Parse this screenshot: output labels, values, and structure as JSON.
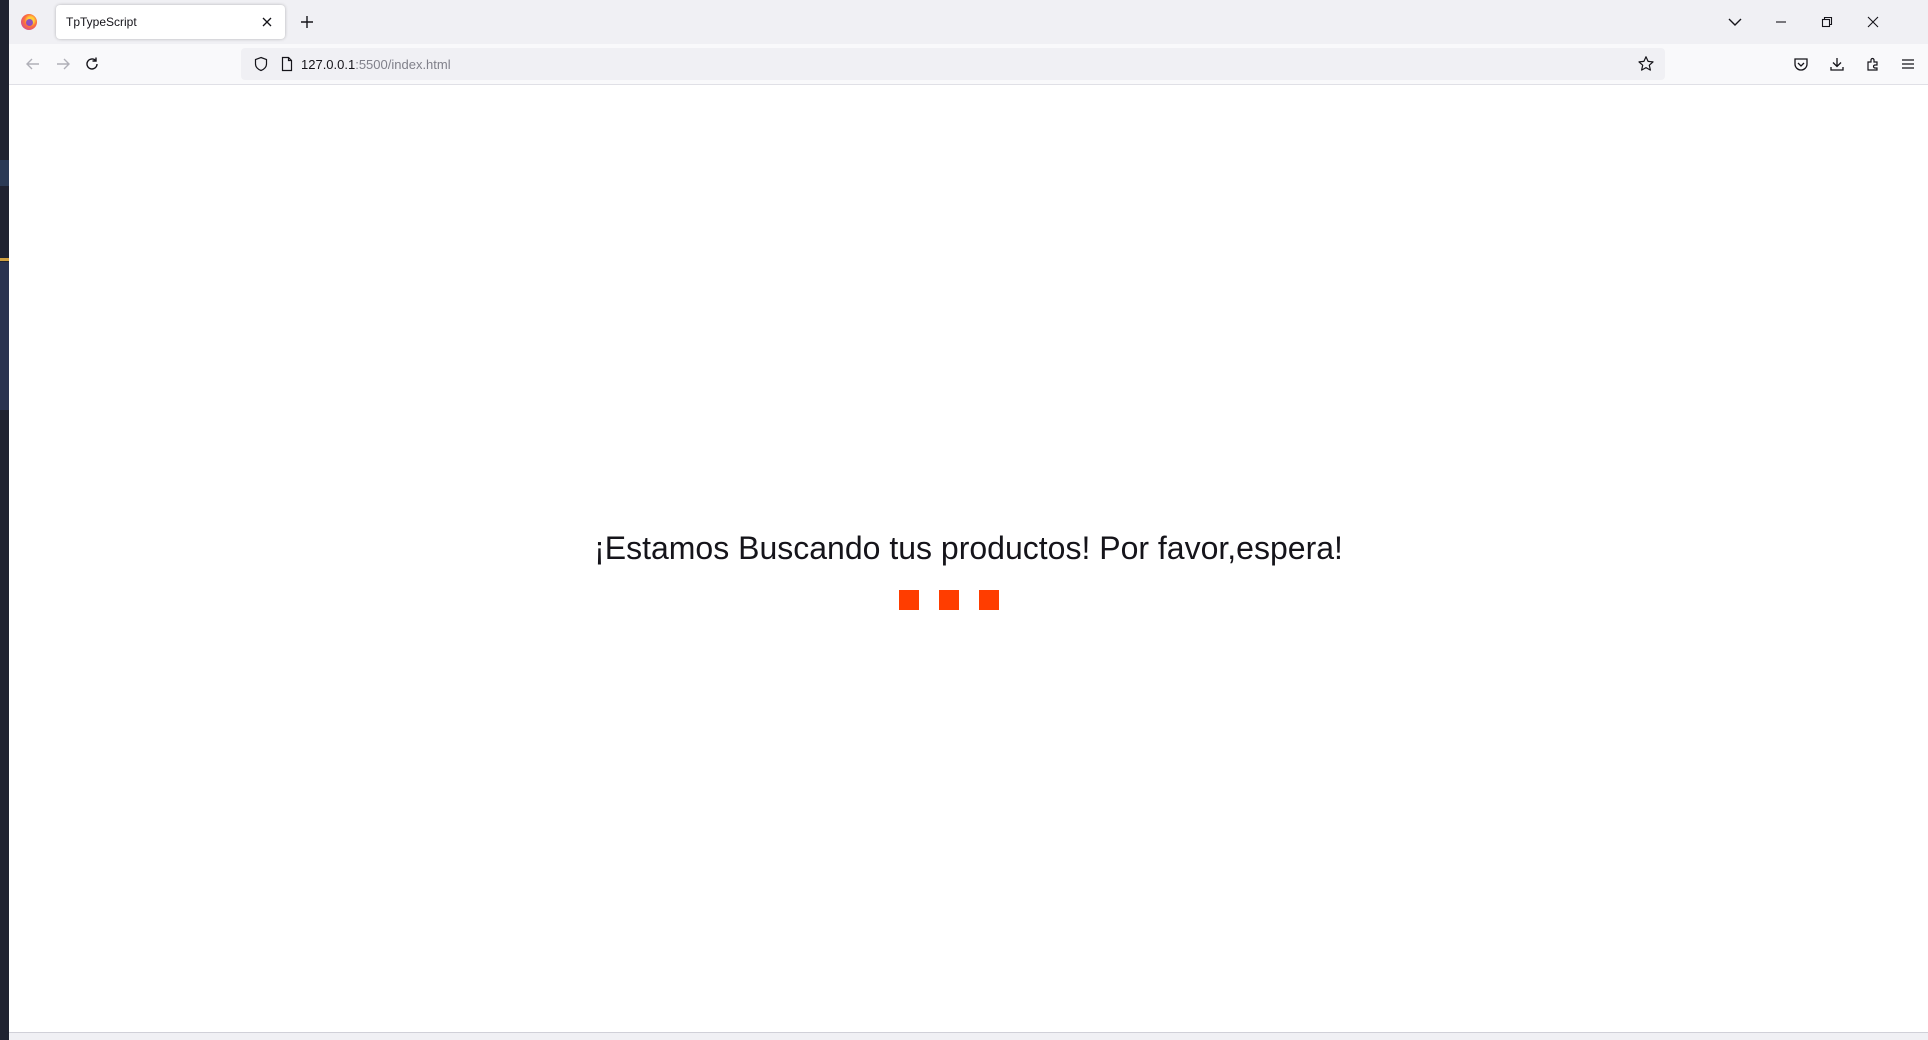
{
  "browser": {
    "tab": {
      "title": "TpTypeScript"
    },
    "url": {
      "host": "127.0.0.1",
      "path": ":5500/index.html"
    }
  },
  "page": {
    "loading_message": "¡Estamos Buscando tus productos! Por favor,espera!",
    "loader_color": "#ff3d00"
  },
  "icons": {
    "firefox": "firefox-logo-icon",
    "tab_close": "close-icon",
    "new_tab": "plus-icon",
    "list_tabs": "chevron-down-icon",
    "minimize": "minimize-icon",
    "restore": "restore-icon",
    "close_window": "close-icon",
    "back": "arrow-left-icon",
    "forward": "arrow-right-icon",
    "reload": "reload-icon",
    "shield": "shield-icon",
    "page": "page-icon",
    "star": "star-icon",
    "pocket": "pocket-icon",
    "download": "download-icon",
    "extensions": "puzzle-icon",
    "menu": "hamburger-menu-icon"
  }
}
